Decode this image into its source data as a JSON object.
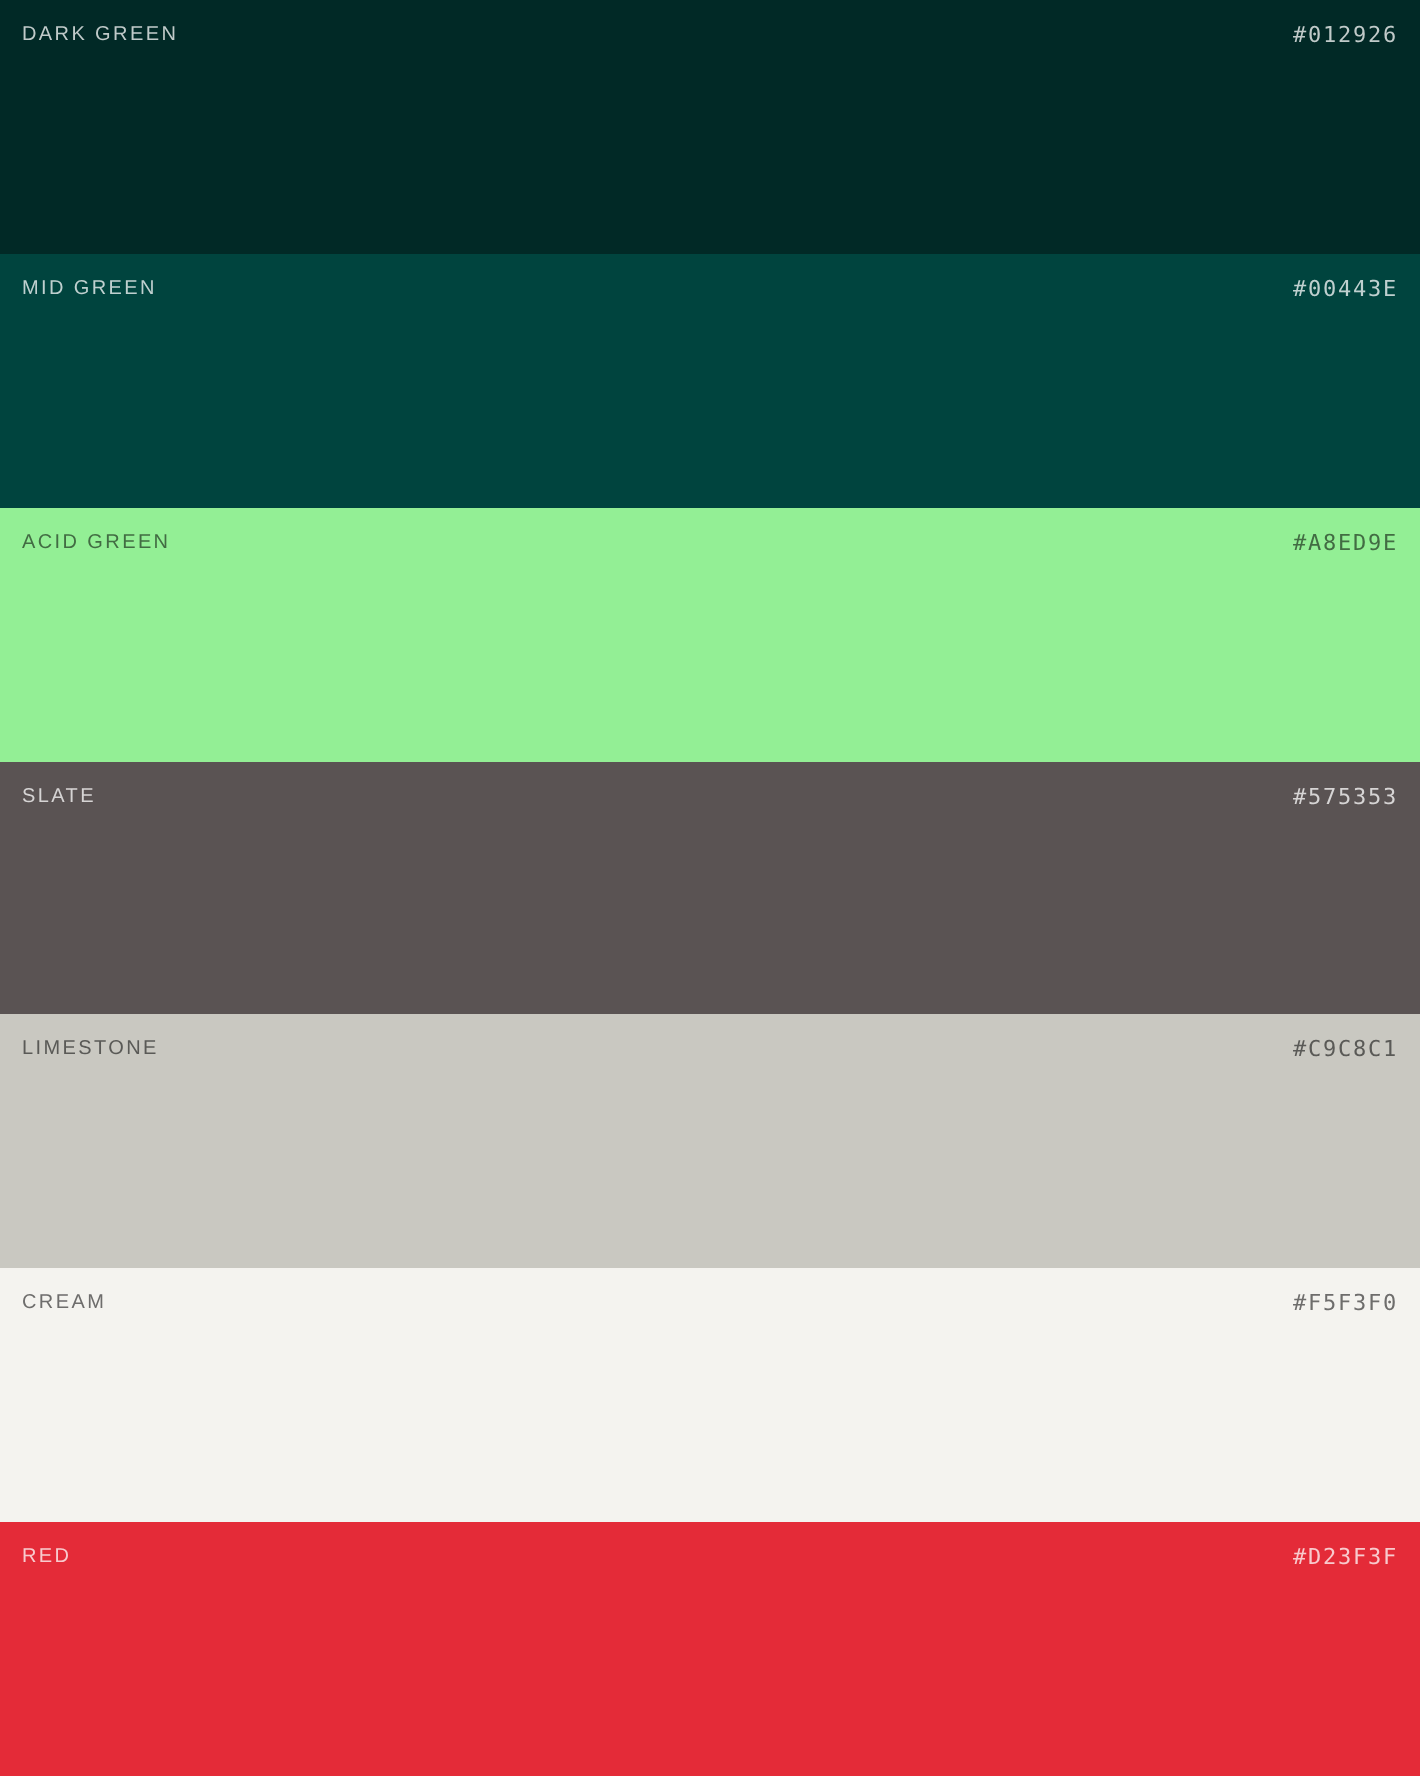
{
  "swatches": [
    {
      "name": "DARK GREEN",
      "hex": "#012926",
      "color": "#012926"
    },
    {
      "name": "MID GREEN",
      "hex": "#00443E",
      "color": "#00443e"
    },
    {
      "name": "ACID GREEN",
      "hex": "#A8ED9E",
      "color": "#93ef95"
    },
    {
      "name": "SLATE",
      "hex": "#575353",
      "color": "#5a5353"
    },
    {
      "name": "LIMESTONE",
      "hex": "#C9C8C1",
      "color": "#c9c8c1"
    },
    {
      "name": "CREAM",
      "hex": "#F5F3F0",
      "color": "#f4f3ef"
    },
    {
      "name": "RED",
      "hex": "#D23F3F",
      "color": "#e42b38"
    }
  ]
}
